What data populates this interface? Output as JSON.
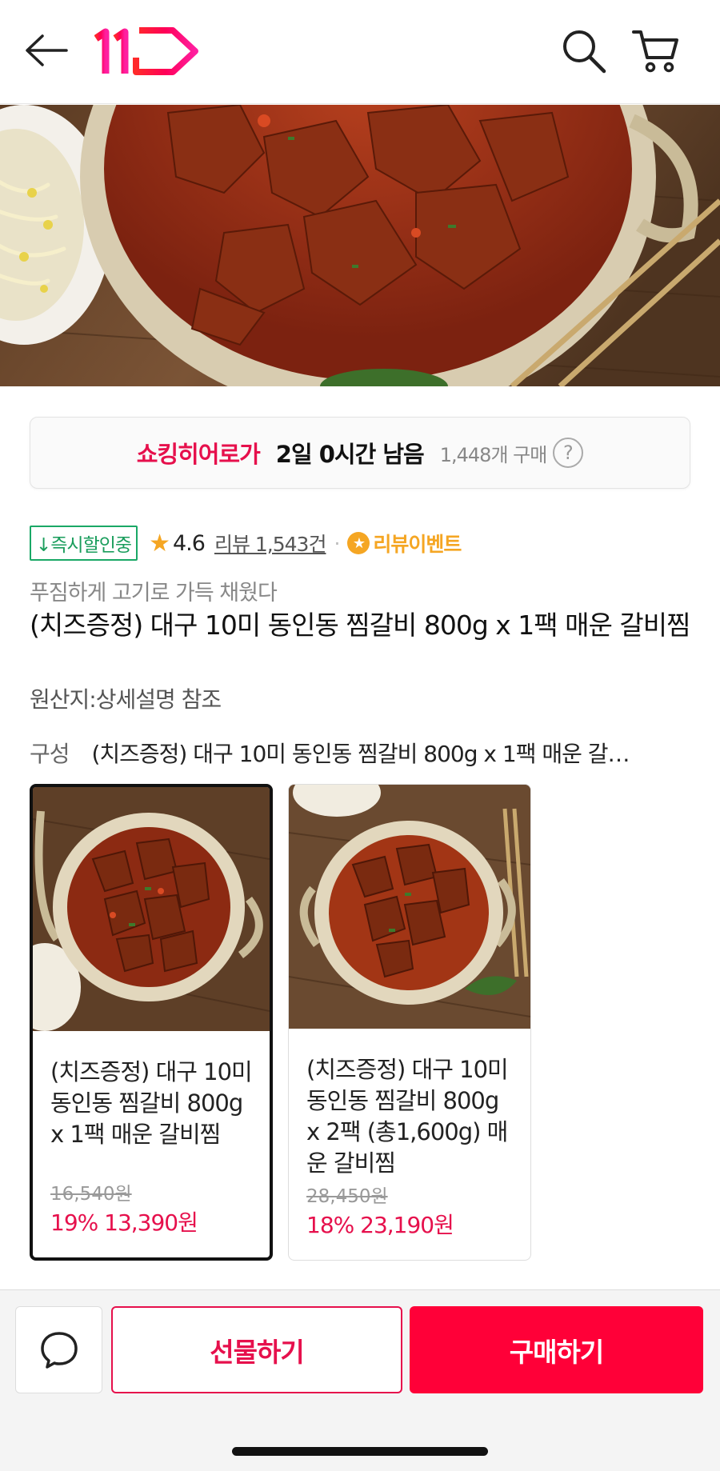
{
  "header": {
    "logo_text": "11",
    "back_icon": "back-arrow-icon",
    "search_icon": "search-icon",
    "cart_icon": "cart-icon"
  },
  "timer": {
    "brand": "쇼킹히어로가",
    "time_left": "2일 0시간 남음",
    "purchase_count": "1,448개 구매",
    "help_icon": "?"
  },
  "rating_row": {
    "cert_badge": "↓즉시할인중",
    "rating": "4.6",
    "review_link": "리뷰 1,543건",
    "separator": "·",
    "event_label": "리뷰이벤트"
  },
  "product": {
    "subtitle": "푸짐하게 고기로 가득 채웠다",
    "title": "(치즈증정) 대구 10미 동인동 찜갈비 800g x 1팩 매운 갈비찜",
    "origin": "원산지:상세설명 참조"
  },
  "option": {
    "label": "구성",
    "value": "(치즈증정) 대구 10미 동인동 찜갈비 800g x 1팩 매운 갈…"
  },
  "cards": [
    {
      "name": "(치즈증정) 대구 10미 동인동 찜갈비 800g x 1팩 매운 갈비찜",
      "original_price": "16,540원",
      "sale": "19% 13,390원",
      "selected": true
    },
    {
      "name": "(치즈증정) 대구 10미 동인동 찜갈비 800g x 2팩 (총1,600g) 매운 갈비찜",
      "original_price": "28,450원",
      "sale": "18% 23,190원",
      "selected": false
    }
  ],
  "bottom_bar": {
    "chat_icon": "chat-bubble-icon",
    "gift_label": "선물하기",
    "buy_label": "구매하기"
  },
  "colors": {
    "brand_red": "#ff0038",
    "accent_pink": "#e6104c",
    "star_yellow": "#f5a623",
    "badge_green": "#1aa866"
  }
}
